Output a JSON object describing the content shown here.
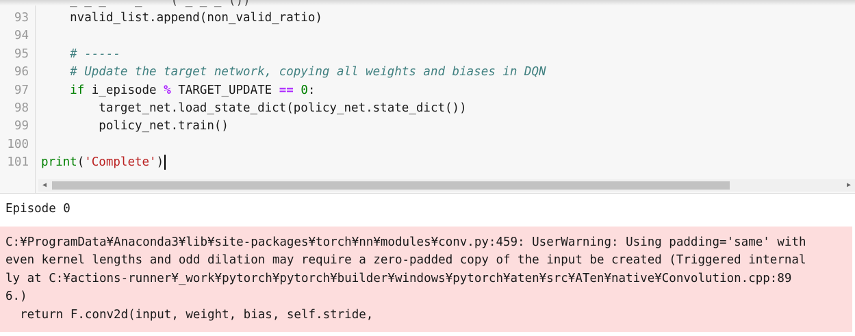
{
  "editor": {
    "partial_top_line": "    _ _ _    _    ( _ _ _ ())",
    "lines": [
      {
        "num": "93",
        "parts": [
          {
            "t": "    nvalid_list.append(non_valid_ratio)",
            "c": ""
          }
        ]
      },
      {
        "num": "94",
        "parts": []
      },
      {
        "num": "95",
        "parts": [
          {
            "t": "    ",
            "c": ""
          },
          {
            "t": "# -----",
            "c": "cm"
          }
        ]
      },
      {
        "num": "96",
        "parts": [
          {
            "t": "    ",
            "c": ""
          },
          {
            "t": "# Update the target network, copying all weights and biases in DQN",
            "c": "cm"
          }
        ]
      },
      {
        "num": "97",
        "parts": [
          {
            "t": "    ",
            "c": ""
          },
          {
            "t": "if",
            "c": "kw"
          },
          {
            "t": " i_episode ",
            "c": ""
          },
          {
            "t": "%",
            "c": "op"
          },
          {
            "t": " TARGET_UPDATE ",
            "c": ""
          },
          {
            "t": "==",
            "c": "op"
          },
          {
            "t": " ",
            "c": ""
          },
          {
            "t": "0",
            "c": "num"
          },
          {
            "t": ":",
            "c": ""
          }
        ]
      },
      {
        "num": "98",
        "parts": [
          {
            "t": "        target_net.load_state_dict(policy_net.state_dict())",
            "c": ""
          }
        ]
      },
      {
        "num": "99",
        "parts": [
          {
            "t": "        policy_net.train()",
            "c": ""
          }
        ]
      },
      {
        "num": "100",
        "parts": []
      },
      {
        "num": "101",
        "parts": [
          {
            "t": "print",
            "c": "bi"
          },
          {
            "t": "(",
            "c": ""
          },
          {
            "t": "'Complete'",
            "c": "str"
          },
          {
            "t": ")",
            "c": ""
          }
        ]
      }
    ]
  },
  "scrollbar": {
    "left_arrow": "◀",
    "right_arrow": "▶"
  },
  "output": {
    "stdout": "Episode 0",
    "stderr_lines": [
      "C:¥ProgramData¥Anaconda3¥lib¥site-packages¥torch¥nn¥modules¥conv.py:459: UserWarning: Using padding='same' with",
      "even kernel lengths and odd dilation may require a zero-padded copy of the input be created (Triggered internal",
      "ly at C:¥actions-runner¥_work¥pytorch¥pytorch¥builder¥windows¥pytorch¥aten¥src¥ATen¥native¥Convolution.cpp:89",
      "6.)",
      "  return F.conv2d(input, weight, bias, self.stride,"
    ]
  }
}
